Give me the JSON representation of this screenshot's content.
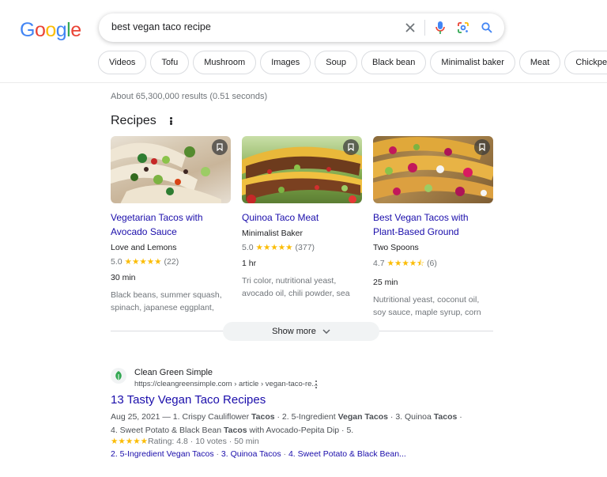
{
  "logo": {
    "letters": [
      "G",
      "o",
      "o",
      "g",
      "l",
      "e"
    ],
    "colors": [
      "#4285F4",
      "#EA4335",
      "#FBBC05",
      "#4285F4",
      "#34A853",
      "#EA4335"
    ]
  },
  "search": {
    "query": "best vegan taco recipe",
    "icons": [
      "clear-icon",
      "microphone-icon",
      "lens-icon",
      "search-icon"
    ]
  },
  "chips": [
    "Videos",
    "Tofu",
    "Mushroom",
    "Images",
    "Soup",
    "Black bean",
    "Minimalist baker",
    "Meat",
    "Chickpeas"
  ],
  "stats": "About 65,300,000 results (0.51 seconds)",
  "recipes": {
    "title": "Recipes",
    "show_more": "Show more",
    "cards": [
      {
        "title_l1": "Vegetarian Tacos with",
        "title_l2": "Avocado Sauce",
        "source": "Love and Lemons",
        "rating": "5.0",
        "stars": "★★★★★",
        "count": "(22)",
        "time": "30 min",
        "ing_l1": "Black beans, summer squash,",
        "ing_l2": "spinach, japanese eggplant,"
      },
      {
        "title_l1": "Quinoa Taco Meat",
        "title_l2": "",
        "source": "Minimalist Baker",
        "rating": "5.0",
        "stars": "★★★★★",
        "count": "(377)",
        "time": "1 hr",
        "ing_l1": "Tri color, nutritional yeast,",
        "ing_l2": "avocado oil, chili powder, sea"
      },
      {
        "title_l1": "Best Vegan Tacos with",
        "title_l2": "Plant-Based Ground",
        "source": "Two Spoons",
        "rating": "4.7",
        "stars": "★★★★⯪",
        "count": "(6)",
        "time": "25 min",
        "ing_l1": "Nutritional yeast, coconut oil,",
        "ing_l2": "soy sauce, maple syrup, corn"
      }
    ]
  },
  "result": {
    "site": "Clean Green Simple",
    "url": "https://cleangreensimple.com › article › vegan-taco-re...",
    "title": "13 Tasty Vegan Taco Recipes",
    "snip1": {
      "a": "Aug 25, 2021 — 1. Crispy Cauliflower ",
      "b": "Tacos",
      "c": " · 2. 5-Ingredient ",
      "d": "Vegan Tacos",
      "e": " · 3. Quinoa ",
      "f": "Tacos",
      "g": " ·"
    },
    "snip2": {
      "a": "4. Sweet Potato & Black Bean ",
      "b": "Tacos",
      "c": " with Avocado-Pepita Dip · 5."
    },
    "stars": "★★★★★",
    "rating_text": "Rating: 4.8 · 10 votes · 50 min",
    "sitelinks": [
      "2. 5-Ingredient Vegan Tacos",
      "3. Quinoa Tacos",
      "4. Sweet Potato & Black Bean..."
    ]
  }
}
